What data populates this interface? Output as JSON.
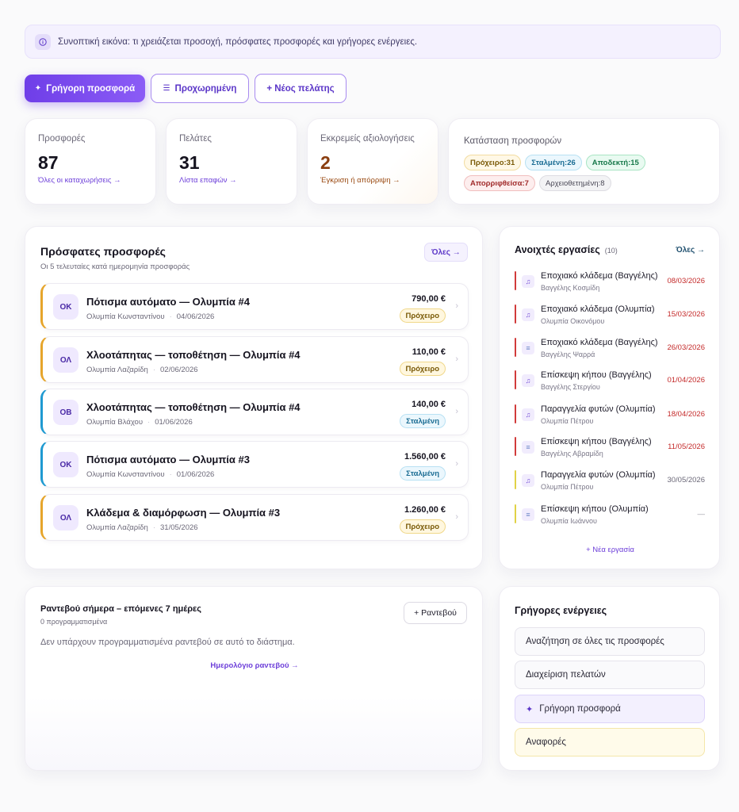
{
  "banner": {
    "text": "Συνοπτική εικόνα: τι χρειάζεται προσοχή, πρόσφατες προσφορές και γρήγορες ενέργειες."
  },
  "actions": {
    "quick_offer": "Γρήγορη προσφορά",
    "advanced": "Προχωρημένη",
    "new_client": "+ Νέος πελάτης"
  },
  "stats": [
    {
      "label": "Προσφορές",
      "value": "87",
      "link": "Όλες οι καταχωρήσεις →"
    },
    {
      "label": "Πελάτες",
      "value": "31",
      "link": "Λίστα επαφών →"
    },
    {
      "label": "Εκκρεμείς αξιολογήσεις",
      "value": "2",
      "link": "Έγκριση ή απόρριψη →"
    }
  ],
  "status": {
    "title": "Κατάσταση προσφορών",
    "chips": [
      {
        "label": "Πρόχειρο:31"
      },
      {
        "label": "Σταλμένη:26"
      },
      {
        "label": "Αποδεκτή:15"
      },
      {
        "label": "Απορριφθείσα:7"
      },
      {
        "label": "Αρχειοθετημένη:8"
      }
    ]
  },
  "recent": {
    "title": "Πρόσφατες προσφορές",
    "subtitle": "Οι 5 τελευταίες κατά ημερομηνία προσφοράς",
    "all_label": "Όλες →",
    "items": [
      {
        "initials": "ΟΚ",
        "title": "Πότισμα αυτόματο — Ολυμπία #4",
        "client": "Ολυμπία Κωνσταντίνου",
        "date": "04/06/2026",
        "amount": "790,00 €",
        "status": "Πρόχειρο"
      },
      {
        "initials": "ΟΛ",
        "title": "Χλοοτάπητας — τοποθέτηση — Ολυμπία #4",
        "client": "Ολυμπία Λαζαρίδη",
        "date": "02/06/2026",
        "amount": "110,00 €",
        "status": "Πρόχειρο"
      },
      {
        "initials": "ΟΒ",
        "title": "Χλοοτάπητας — τοποθέτηση — Ολυμπία #4",
        "client": "Ολυμπία Βλάχου",
        "date": "01/06/2026",
        "amount": "140,00 €",
        "status": "Σταλμένη"
      },
      {
        "initials": "ΟΚ",
        "title": "Πότισμα αυτόματο — Ολυμπία #3",
        "client": "Ολυμπία Κωνσταντίνου",
        "date": "01/06/2026",
        "amount": "1.560,00 €",
        "status": "Σταλμένη"
      },
      {
        "initials": "ΟΛ",
        "title": "Κλάδεμα & διαμόρφωση — Ολυμπία #3",
        "client": "Ολυμπία Λαζαρίδη",
        "date": "31/05/2026",
        "amount": "1.260,00 €",
        "status": "Πρόχειρο"
      }
    ]
  },
  "tasks": {
    "title": "Ανοιχτές εργασίες",
    "count": "(10)",
    "all_label": "Όλες →",
    "new_label": "+ Νέα εργασία",
    "items": [
      {
        "title": "Εποχιακό κλάδεμα (Βαγγέλης)",
        "person": "Βαγγέλης Κοσμίδη",
        "date": "08/03/2026"
      },
      {
        "title": "Εποχιακό κλάδεμα (Ολυμπία)",
        "person": "Ολυμπία Οικονόμου",
        "date": "15/03/2026"
      },
      {
        "title": "Εποχιακό κλάδεμα (Βαγγέλης)",
        "person": "Βαγγέλης Ψαρρά",
        "date": "26/03/2026"
      },
      {
        "title": "Επίσκεψη κήπου (Βαγγέλης)",
        "person": "Βαγγέλης Στεργίου",
        "date": "01/04/2026"
      },
      {
        "title": "Παραγγελία φυτών (Ολυμπία)",
        "person": "Ολυμπία Πέτρου",
        "date": "18/04/2026"
      },
      {
        "title": "Επίσκεψη κήπου (Βαγγέλης)",
        "person": "Βαγγέλης Αβραμίδη",
        "date": "11/05/2026"
      },
      {
        "title": "Παραγγελία φυτών (Ολυμπία)",
        "person": "Ολυμπία Πέτρου",
        "date": "30/05/2026"
      },
      {
        "title": "Επίσκεψη κήπου (Ολυμπία)",
        "person": "Ολυμπία Ιωάννου",
        "date": "—"
      }
    ]
  },
  "appointments": {
    "title": "Ραντεβού σήμερα – επόμενες 7 ημέρες",
    "subtitle": "0 προγραμματισμένα",
    "add_label": "+ Ραντεβού",
    "empty": "Δεν υπάρχουν προγραμματισμένα ραντεβού σε αυτό το διάστημα.",
    "calendar_link": "Ημερολόγιο ραντεβού →"
  },
  "quick": {
    "title": "Γρήγορες ενέργειες",
    "items": [
      {
        "label": "Αναζήτηση σε όλες τις προσφορές"
      },
      {
        "label": "Διαχείριση πελατών"
      },
      {
        "label": "Γρήγορη προσφορά"
      },
      {
        "label": "Αναφορές"
      }
    ]
  },
  "colors": {
    "accent": "#6f3ee8",
    "draft": "#e6a52b",
    "sent": "#1f9ad1",
    "overdue": "#d13b3b",
    "upcoming": "#e1d246"
  },
  "icons": {
    "banner": "info-icon",
    "quick_offer": "sparkle-icon",
    "advanced": "list-icon",
    "task_bell": "bell-icon",
    "task_list": "list-icon",
    "chevron": "chevron-right-icon"
  }
}
